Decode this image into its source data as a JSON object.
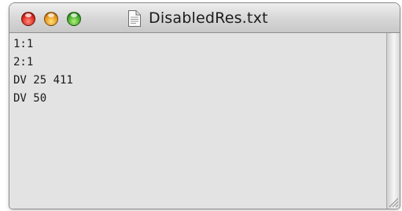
{
  "window": {
    "title": "DisabledRes.txt"
  },
  "icons": {
    "close": "close-button",
    "minimize": "minimize-button",
    "zoom": "zoom-button",
    "document": "text-document-icon",
    "grip": "resize-grip-icon"
  },
  "document": {
    "lines": [
      "1:1",
      "2:1",
      "DV 25 411",
      "DV 50"
    ]
  }
}
